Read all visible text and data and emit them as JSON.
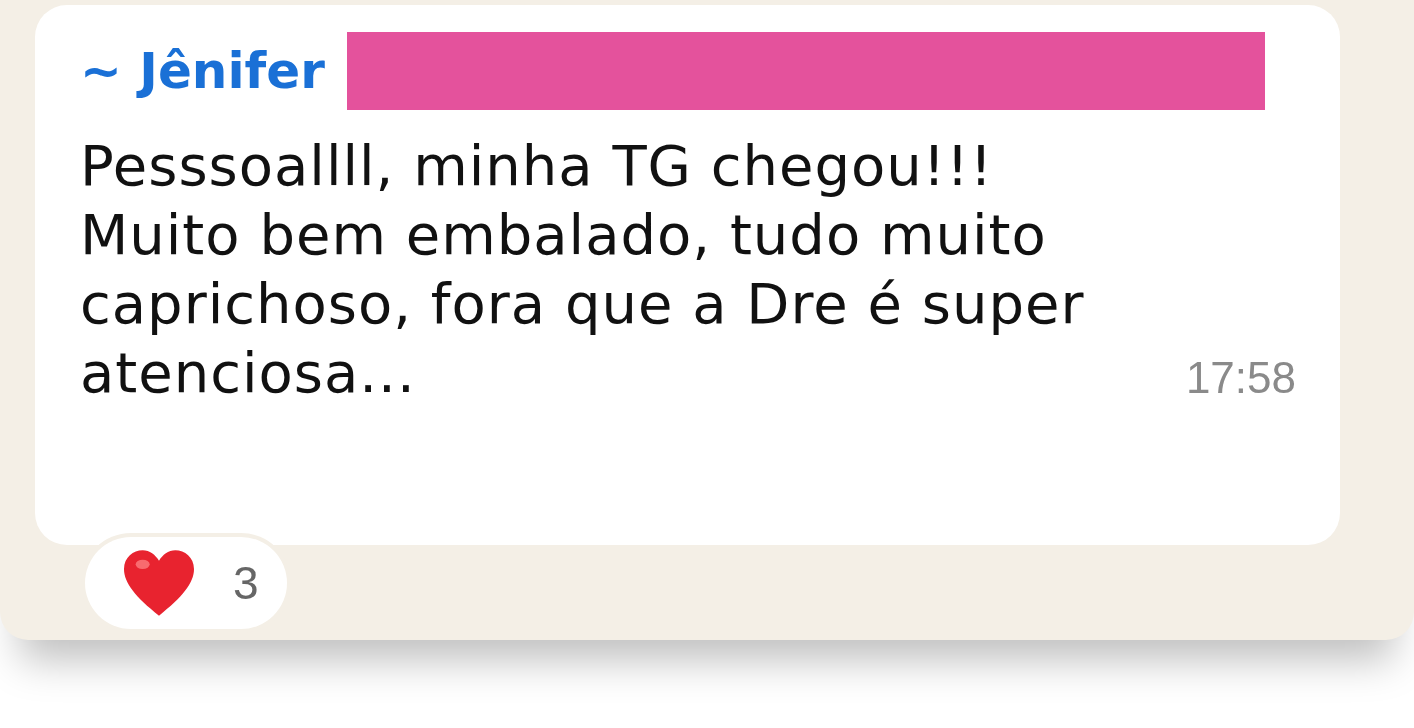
{
  "message": {
    "sender": "~ Jênifer",
    "sender_redacted": true,
    "text": "Pesssoallll, minha TG chegou!!!\nMuito bem embalado, tudo muito\ncaprichoso, fora que a Dre é super\natenciosa...",
    "time": "17:58"
  },
  "reactions": [
    {
      "count": "3"
    }
  ]
}
